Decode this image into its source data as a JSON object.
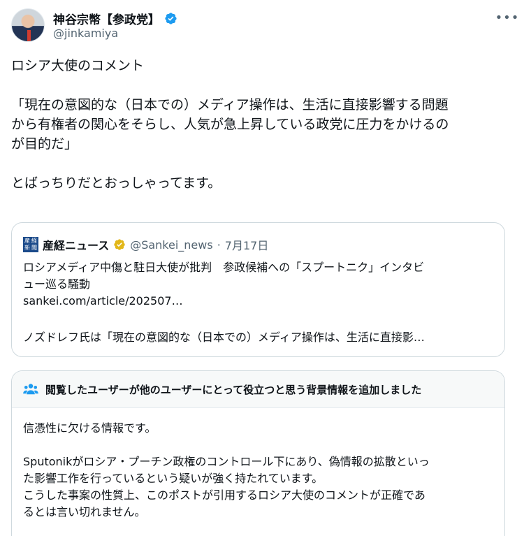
{
  "author": {
    "display_name": "神谷宗幣【参政党】",
    "handle": "@jinkamiya"
  },
  "tweet": {
    "text": "ロシア大使のコメント\n\n「現在の意図的な（日本での）メディア操作は、生活に直接影響する問題\nから有権者の関心をそらし、人気が急上昇している政党に圧力をかけるの\nが目的だ」\n\nとばっちりだとおっしゃってます。"
  },
  "quote": {
    "display_name": "産経ニュース",
    "handle": "@Sankei_news",
    "separator": "·",
    "date": "7月17日",
    "logo_chars": [
      "産",
      "経",
      "新",
      "聞"
    ],
    "body": "ロシアメディア中傷と駐日大使が批判　参政候補への「スプートニク」インタビ\nュー巡る騒動\nsankei.com/article/202507…",
    "body_truncated": "ノズドレフ氏は「現在の意図的な（日本での）メディア操作は、生活に直接影…"
  },
  "community_note": {
    "title": "閲覧したユーザーが他のユーザーにとって役立つと思う背景情報を追加しました",
    "body": "信憑性に欠ける情報です。\n\nSputonikがロシア・プーチン政権のコントロール下にあり、偽情報の拡散といっ\nた影響工作を行っているという疑いが強く持たれています。\nこうした事案の性質上、このポストが引用するロシア大使のコメントが正確であ\nるとは言い切れません。"
  },
  "icons": {
    "verified": "verified-badge-icon",
    "gold_check": "gold-verified-badge-icon",
    "more": "more-options-icon",
    "people": "people-icon"
  },
  "colors": {
    "verified_blue": "#1d9bf0",
    "gold_badge": "#e2b719",
    "note_people_blue": "#1d9bf0",
    "sankei_logo_blue": "#1b4a8a"
  }
}
